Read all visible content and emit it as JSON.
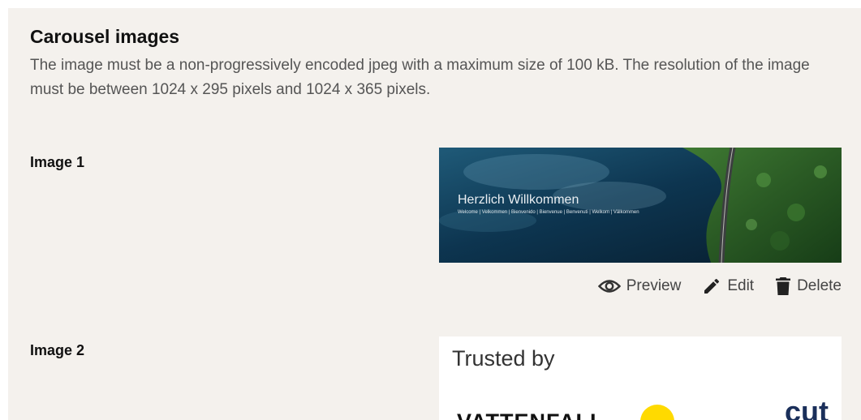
{
  "section": {
    "title": "Carousel images",
    "description": "The image must be a non-progressively encoded jpeg with a maximum size of 100 kB. The resolution of the image must be between 1024 x 295 pixels and 1024 x 365 pixels."
  },
  "images": [
    {
      "label": "Image 1",
      "banner_title": "Herzlich Willkommen",
      "banner_subtitle": "Welcome | Velkommen | Bienvenido | Bienvenue | Benvenuti | Welkom | Välkommen"
    },
    {
      "label": "Image 2",
      "banner_title": "Trusted by",
      "logo_1": "VATTENFALL",
      "logo_2": "cut"
    }
  ],
  "actions": {
    "preview": "Preview",
    "edit": "Edit",
    "delete": "Delete"
  },
  "icons": {
    "preview": "eye-icon",
    "edit": "pencil-icon",
    "delete": "trash-icon"
  }
}
